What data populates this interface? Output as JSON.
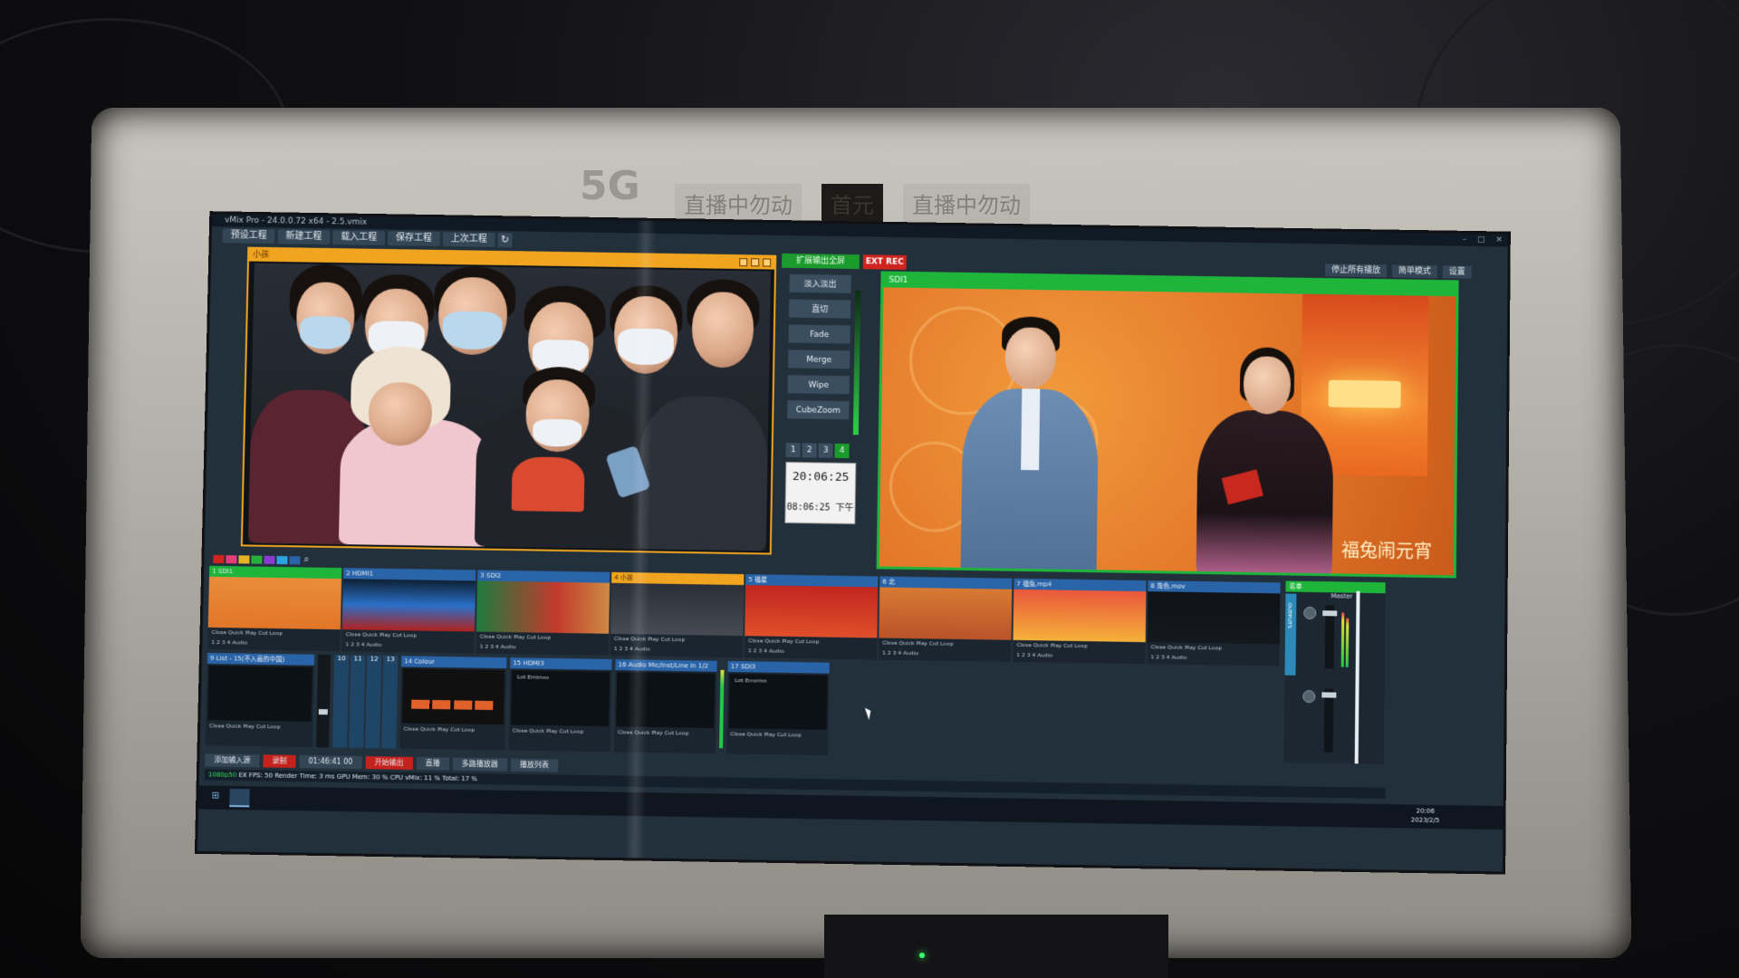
{
  "window": {
    "title": "vMix Pro - 24.0.0.72 x64 - 2.5.vmix"
  },
  "menubar": {
    "items": [
      "预设工程",
      "新建工程",
      "载入工程",
      "保存工程",
      "上次工程"
    ]
  },
  "preview": {
    "label": "小孩"
  },
  "transitions": {
    "ext_output": "扩展输出全屏",
    "ext_rec": "EXT REC",
    "buttons": [
      "淡入淡出",
      "直切",
      "Fade",
      "Merge",
      "Wipe",
      "CubeZoom"
    ],
    "quick_numbers": [
      "1",
      "2",
      "3",
      "4"
    ],
    "active_number": "4"
  },
  "clock": {
    "time_24h": "20:06:25",
    "time_12h": "08:06:25 下午"
  },
  "program": {
    "label": "SDI1",
    "right_buttons": [
      "停止所有播放",
      "简单模式",
      "设置"
    ],
    "caption": "福兔闹元宵"
  },
  "inputs": [
    {
      "num": "1",
      "name": "SDI1",
      "state": "program"
    },
    {
      "num": "2",
      "name": "HDMI1",
      "state": "none"
    },
    {
      "num": "3",
      "name": "SDI2",
      "state": "none"
    },
    {
      "num": "4",
      "name": "小孩",
      "state": "preview"
    },
    {
      "num": "5",
      "name": "福星",
      "state": "none"
    },
    {
      "num": "6",
      "name": "北",
      "state": "none"
    },
    {
      "num": "7",
      "name": "福兔.mp4",
      "state": "none"
    },
    {
      "num": "8",
      "name": "角色.mov",
      "state": "none"
    }
  ],
  "input_controls": "Close  Quick Play  Cut  Loop",
  "input_audio_row": "1  2  3  4    Audio",
  "inputs_second_row": [
    {
      "num": "9",
      "name": "List - 15(不入画的中国)"
    },
    {
      "num": "14",
      "name": "Colour"
    },
    {
      "num": "15",
      "name": "HDMI3"
    },
    {
      "num": "16",
      "name": "Audio Mic/Inst/Line In 1/2"
    },
    {
      "num": "17",
      "name": "SDI3"
    }
  ],
  "fader_numbers": [
    "10",
    "11",
    "12",
    "13"
  ],
  "lower_third_tag": "Lot Errorino",
  "mixer": {
    "head": "名单",
    "master_label": "Master",
    "outputs_label": "OUTPUTS"
  },
  "bottombar": {
    "buttons": [
      "添加输入源",
      "录制",
      "01:46:41 00",
      "开始输出",
      "直播",
      "多路播放器",
      "播放列表"
    ]
  },
  "statusline": {
    "resolution": "1080p50",
    "text": "EX  FPS: 50  Render Time: 3 ms  GPU Mem: 30 %  CPU vMix: 11 %  Total: 17 %"
  },
  "taskbar": {
    "time": "20:06",
    "date": "2023/2/5"
  },
  "bezel": {
    "logo": "5G",
    "signs": [
      "直播中勿动",
      "首元",
      "直播中勿动"
    ]
  },
  "colors": {
    "program_green": "#1fb53b",
    "preview_orange": "#f0a41f",
    "rec_red": "#d0241f",
    "button_steel": "#344656"
  }
}
